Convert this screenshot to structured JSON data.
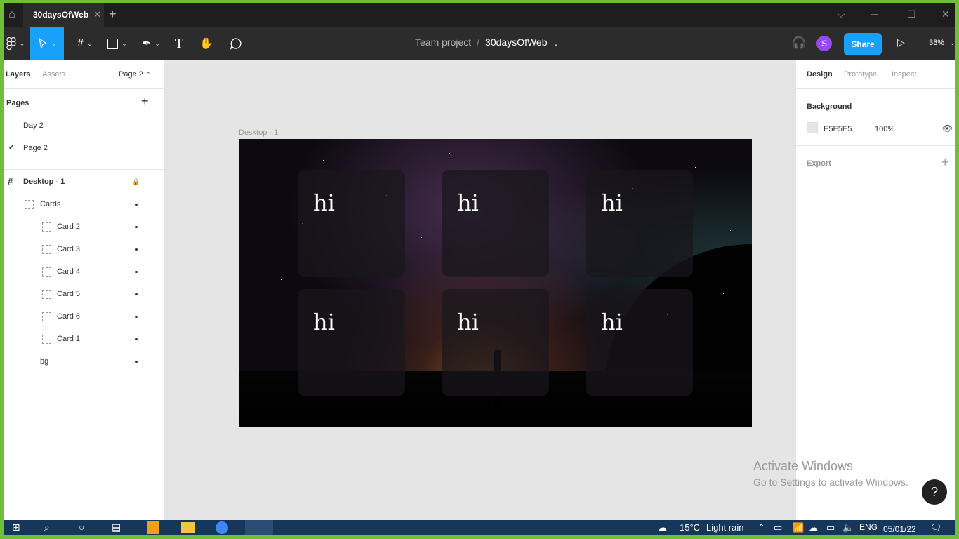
{
  "window": {
    "tab_title": "30daysOfWeb",
    "close_glyph": "✕",
    "new_tab_glyph": "+",
    "controls": [
      "⌵",
      "─",
      "☐",
      "✕"
    ]
  },
  "toolbar": {
    "breadcrumb_team": "Team project",
    "breadcrumb_sep": "/",
    "file_name": "30daysOfWeb",
    "avatar_letter": "S",
    "share_label": "Share",
    "zoom": "38%"
  },
  "left_panel": {
    "tabs": {
      "layers": "Layers",
      "assets": "Assets",
      "page": "Page 2"
    },
    "pages_heading": "Pages",
    "pages": [
      "Day 2",
      "Page 2"
    ],
    "current_page": "Page 2",
    "layers": [
      {
        "name": "Desktop - 1",
        "type": "frame"
      },
      {
        "name": "Cards",
        "type": "group"
      },
      {
        "name": "Card 2",
        "type": "group"
      },
      {
        "name": "Card 3",
        "type": "group"
      },
      {
        "name": "Card 4",
        "type": "group"
      },
      {
        "name": "Card 5",
        "type": "group"
      },
      {
        "name": "Card 6",
        "type": "group"
      },
      {
        "name": "Card 1",
        "type": "group"
      },
      {
        "name": "bg",
        "type": "image"
      }
    ]
  },
  "canvas": {
    "frame_label": "Desktop - 1",
    "cards": [
      "hi",
      "hi",
      "hi",
      "hi",
      "hi",
      "hi"
    ]
  },
  "right_panel": {
    "tabs": {
      "design": "Design",
      "prototype": "Prototype",
      "inspect": "Inspect"
    },
    "background_heading": "Background",
    "bg_hex": "E5E5E5",
    "bg_opacity": "100%",
    "export_heading": "Export"
  },
  "watermark": {
    "line1": "Activate Windows",
    "line2": "Go to Settings to activate Windows."
  },
  "help_glyph": "?",
  "taskbar": {
    "temperature": "15°C",
    "weather": "Light rain",
    "language": "ENG",
    "date": "05/01/22"
  },
  "colors": {
    "accent": "#18a0fb",
    "avatar": "#9747ff",
    "toolbar": "#2c2c2c",
    "canvas": "#e5e5e5"
  }
}
